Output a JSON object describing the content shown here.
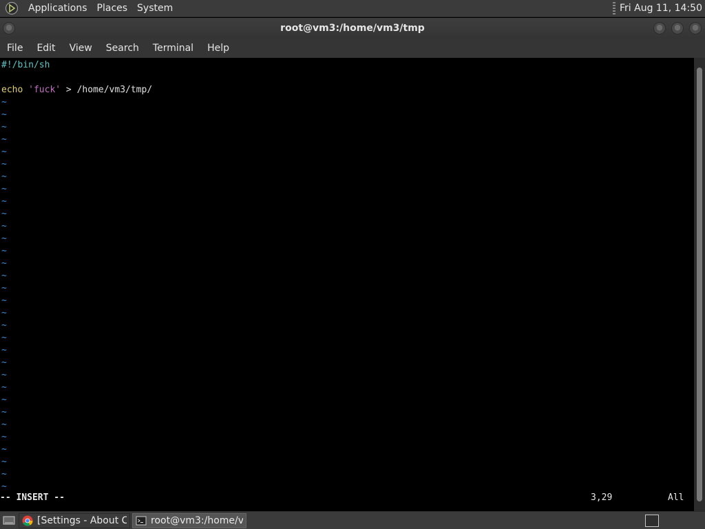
{
  "top_panel": {
    "menus": [
      "Applications",
      "Places",
      "System"
    ],
    "clock": "Fri Aug 11, 14:50"
  },
  "window": {
    "title": "root@vm3:/home/vm3/tmp"
  },
  "menu_bar": [
    "File",
    "Edit",
    "View",
    "Search",
    "Terminal",
    "Help"
  ],
  "editor": {
    "line1": "#!/bin/sh",
    "line3_keyword": "echo",
    "line3_string": "'fuck'",
    "line3_rest": " > /home/vm3/tmp/",
    "tilde": "~",
    "mode": "-- INSERT --",
    "cursor_position": "3,29",
    "file_position": "All"
  },
  "taskbar": {
    "tasks": [
      {
        "label": "[Settings - About C...",
        "icon": "chrome-icon"
      },
      {
        "label": "root@vm3:/home/v...",
        "icon": "terminal-icon"
      }
    ]
  },
  "colors": {
    "background": "#000000",
    "tilde": "#3a8ed6",
    "shebang": "#5ec4c4",
    "keyword": "#e0d070",
    "string": "#c070c0"
  }
}
